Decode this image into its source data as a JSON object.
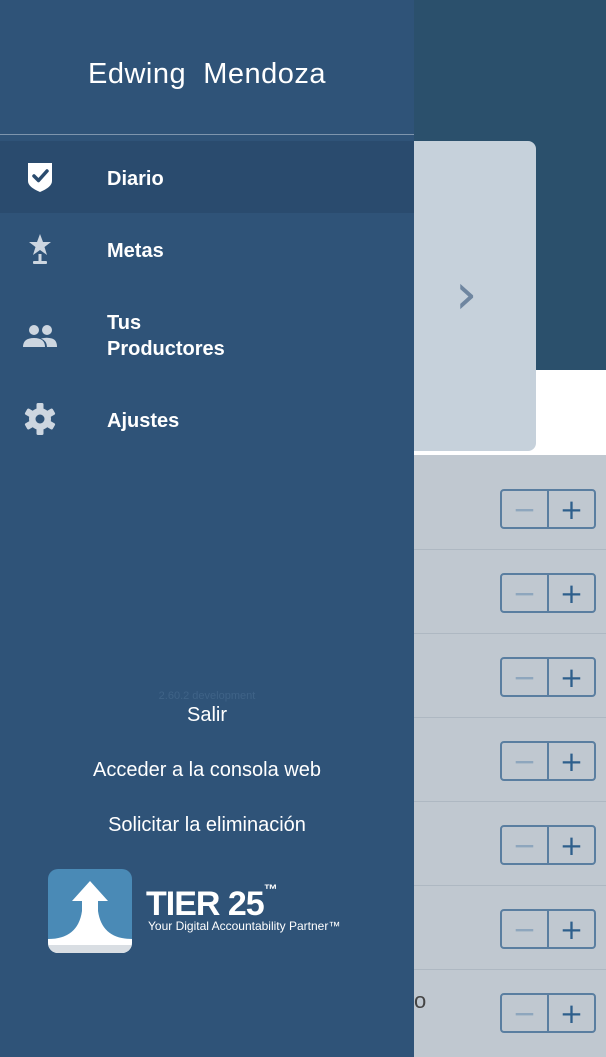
{
  "drawer": {
    "user_name": "Edwing  Mendoza",
    "nav": [
      {
        "label": "Diario",
        "icon": "checkmark-shield-icon",
        "active": true
      },
      {
        "label": "Metas",
        "icon": "trophy-star-icon",
        "active": false
      },
      {
        "label": "Tus\nProductores",
        "icon": "people-icon",
        "active": false
      },
      {
        "label": "Ajustes",
        "icon": "gear-icon",
        "active": false
      }
    ],
    "version": "2.60.2 development",
    "logout": "Salir",
    "web_console": "Acceder a la consola web",
    "request_deletion": "Solicitar la eliminación"
  },
  "logo": {
    "name": "TIER 25",
    "trademark": "™",
    "tagline": "Your Digital Accountability Partner™"
  },
  "background": {
    "stepper_minus": "−",
    "stepper_plus": "+",
    "fragment": "o"
  },
  "colors": {
    "drawer_bg": "#2f5378",
    "active_item_bg": "#2a4b6e",
    "logo_tile": "#4a8ab6"
  }
}
